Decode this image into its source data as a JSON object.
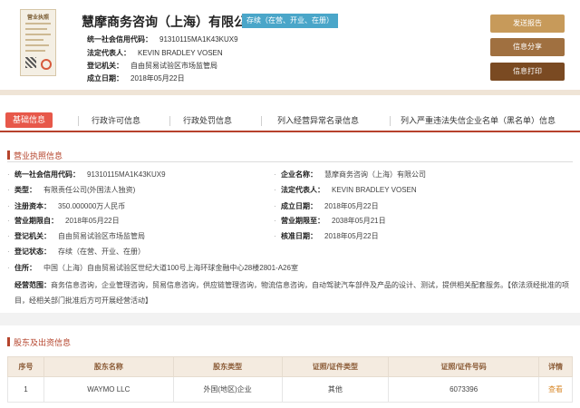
{
  "license": {
    "title": "营业执照"
  },
  "header": {
    "company_name": "慧摩商务咨询（上海）有限公司",
    "status": "存续（在营、开业、在册）",
    "fields": [
      {
        "label": "统一社会信用代码：",
        "value": "91310115MA1K43KUX9"
      },
      {
        "label": "法定代表人：",
        "value": "KEVIN BRADLEY VOSEN"
      },
      {
        "label": "登记机关：",
        "value": "自由贸易试验区市场监管局"
      },
      {
        "label": "成立日期：",
        "value": "2018年05月22日"
      }
    ],
    "buttons": {
      "send_report": "发送报告",
      "share": "信息分享",
      "print": "信息打印"
    }
  },
  "tabs": [
    "基础信息",
    "行政许可信息",
    "行政处罚信息",
    "列入经营异常名录信息",
    "列入严重违法失信企业名单（黑名单）信息"
  ],
  "business_license": {
    "title": "营业执照信息",
    "left": [
      {
        "label": "统一社会信用代码：",
        "value": "91310115MA1K43KUX9"
      },
      {
        "label": "类型：",
        "value": "有限责任公司(外国法人独资)"
      },
      {
        "label": "注册资本：",
        "value": "350.000000万人民币"
      },
      {
        "label": "营业期限自：",
        "value": "2018年05月22日"
      },
      {
        "label": "登记机关：",
        "value": "自由贸易试验区市场监管局"
      },
      {
        "label": "登记状态：",
        "value": "存续（在营、开业、在册）"
      }
    ],
    "right": [
      {
        "label": "企业名称：",
        "value": "慧摩商务咨询（上海）有限公司"
      },
      {
        "label": "法定代表人：",
        "value": "KEVIN BRADLEY VOSEN"
      },
      {
        "label": "成立日期：",
        "value": "2018年05月22日"
      },
      {
        "label": "营业期限至：",
        "value": "2038年05月21日"
      },
      {
        "label": "核准日期：",
        "value": "2018年05月22日"
      }
    ],
    "address": {
      "label": "住所：",
      "value": "中国（上海）自由贸易试验区世纪大道100号上海环球金融中心28楼2801-A26室"
    },
    "scope": {
      "label": "经营范围：",
      "value": "商务信息咨询，企业管理咨询，贸易信息咨询，供应链管理咨询，物流信息咨询，自动驾驶汽车部件及产品的设计、测试，提供相关配套服务。【依法须经批准的项目，经相关部门批准后方可开展经营活动】"
    }
  },
  "shareholders": {
    "title": "股东及出资信息",
    "columns": [
      "序号",
      "股东名称",
      "股东类型",
      "证照/证件类型",
      "证照/证件号码",
      "详情"
    ],
    "rows": [
      {
        "no": "1",
        "name": "WAYMO LLC",
        "type": "外国(地区)企业",
        "id_type": "其他",
        "id_no": "6073396",
        "detail": "查看"
      }
    ]
  }
}
